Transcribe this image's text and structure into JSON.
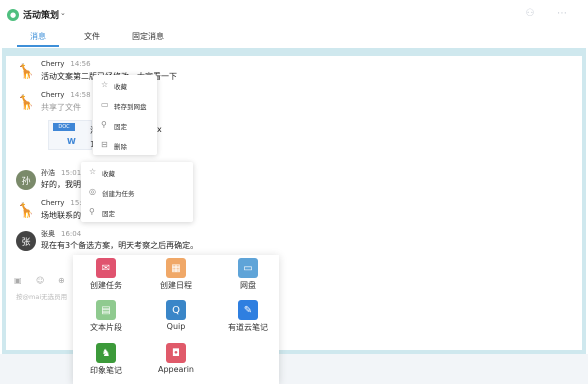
{
  "header": {
    "title": "活动策划",
    "tabs": [
      "消息",
      "文件",
      "固定消息"
    ],
    "active_tab": "消息",
    "accent": "#3d8fd8"
  },
  "messages": [
    {
      "sender": "Cherry",
      "time": "14:56",
      "text": "活动文案第二版已经修改，大家看一下",
      "avatar": "giraffe"
    },
    {
      "sender": "Cherry",
      "time": "14:58",
      "text": "共享了文件",
      "avatar": "giraffe",
      "file": {
        "tag": "DOC",
        "name_prefix": "活",
        "name_suffix": "x",
        "size_prefix": "11"
      }
    },
    {
      "sender": "孙浩",
      "time": "15:01",
      "text": "好的，我明天",
      "avatar": "photo"
    },
    {
      "sender": "Cherry",
      "time": "15:01",
      "text": "场地联系的怎",
      "avatar": "giraffe"
    },
    {
      "sender": "张奥",
      "time": "16:04",
      "text": "现在有3个备选方案，明天考察之后再确定。",
      "avatar": "bw"
    }
  ],
  "context_menu_file": {
    "items": [
      {
        "icon": "star-icon",
        "label": "收藏"
      },
      {
        "icon": "cloud-disk-icon",
        "label": "转存到网盘"
      },
      {
        "icon": "pin-icon",
        "label": "固定"
      },
      {
        "icon": "trash-icon",
        "label": "删除"
      }
    ]
  },
  "context_menu_message": {
    "items": [
      {
        "icon": "star-icon",
        "label": "收藏"
      },
      {
        "icon": "check-circle-icon",
        "label": "创建为任务"
      },
      {
        "icon": "pin-icon",
        "label": "固定"
      }
    ]
  },
  "composer": {
    "placeholder": "按@mai无选员用"
  },
  "apps_panel": {
    "items": [
      {
        "label": "创建任务",
        "color": "#e0536f",
        "icon": "task-icon"
      },
      {
        "label": "创建日程",
        "color": "#f0a868",
        "icon": "calendar-icon"
      },
      {
        "label": "网盘",
        "color": "#5fa4d8",
        "icon": "folder-icon"
      },
      {
        "label": "文本片段",
        "color": "#8fca8f",
        "icon": "snippet-icon"
      },
      {
        "label": "Quip",
        "color": "#3a86c8",
        "icon": "quip-icon"
      },
      {
        "label": "有道云笔记",
        "color": "#2f7fe0",
        "icon": "youdao-note-icon"
      },
      {
        "label": "印象笔记",
        "color": "#3c9a3a",
        "icon": "evernote-icon"
      },
      {
        "label": "Appearin",
        "color": "#e05a6a",
        "icon": "appearin-icon"
      }
    ]
  }
}
